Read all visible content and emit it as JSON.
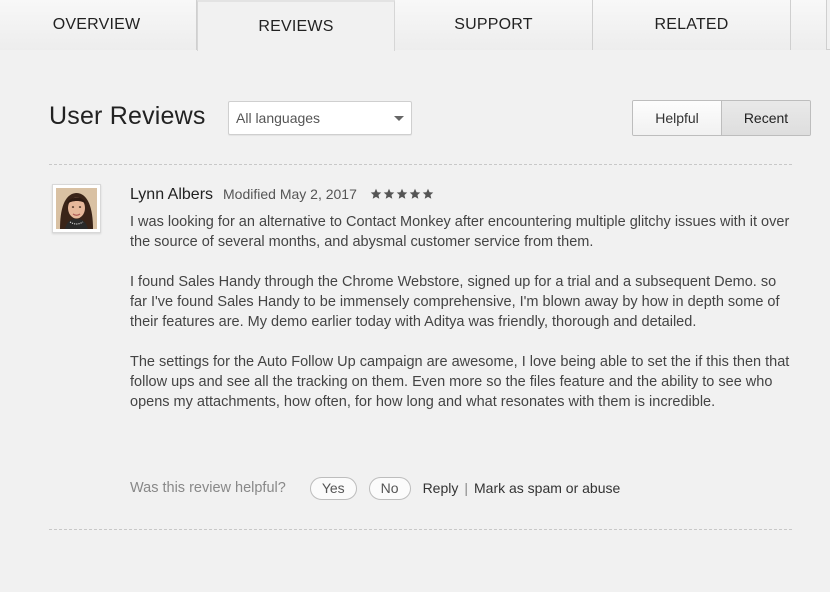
{
  "tabs": {
    "overview": "OVERVIEW",
    "reviews": "REVIEWS",
    "support": "SUPPORT",
    "related": "RELATED"
  },
  "header": {
    "title": "User Reviews",
    "language_select_value": "All languages",
    "sort": {
      "helpful": "Helpful",
      "recent": "Recent",
      "selected": "Recent"
    }
  },
  "review": {
    "author": "Lynn Albers",
    "modified": "Modified May 2, 2017",
    "rating": 5,
    "paragraphs": [
      "I was looking for an alternative to Contact Monkey after encountering multiple glitchy issues with it over the source of several months, and abysmal customer service from them.",
      "I found Sales Handy through the Chrome Webstore, signed up for a trial and a subsequent Demo. so far I've found Sales Handy to be immensely comprehensive, I'm blown away by how in depth some of their features are. My demo earlier today with Aditya was friendly, thorough and detailed.",
      "The settings for the Auto Follow Up campaign are awesome, I love being able to set the if this then that follow ups and see all the tracking on them. Even more so the files feature and the ability to see who opens my attachments, how often, for how long and what resonates with them is incredible."
    ],
    "helpful_question": "Was this review helpful?",
    "yes_label": "Yes",
    "no_label": "No",
    "reply_label": "Reply",
    "separator": "|",
    "spam_label": "Mark as spam or abuse"
  },
  "colors": {
    "background": "#f1f1f1",
    "text": "#444444",
    "star": "#555555"
  },
  "icons": {
    "language_dropdown": "chevron-down-icon",
    "rating": "star-icon"
  }
}
